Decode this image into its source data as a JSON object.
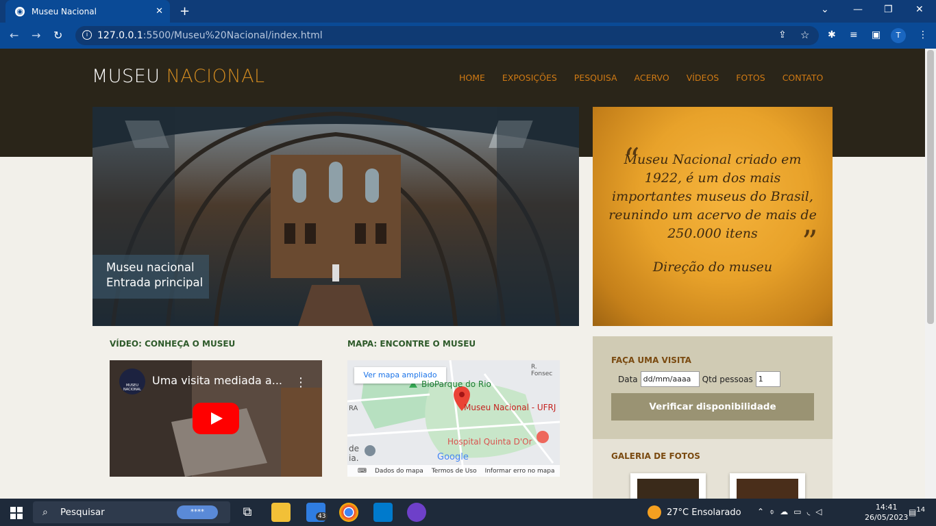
{
  "browser": {
    "tab_title": "Museu Nacional",
    "url_host": "127.0.0.1",
    "url_path": ":5500/Museu%20Nacional/index.html",
    "profile_initial": "T"
  },
  "site": {
    "logo_part1": "MUSEU ",
    "logo_part2": "NACIONAL",
    "nav": [
      "HOME",
      "EXPOSIÇÕES",
      "PESQUISA",
      "ACERVO",
      "VÍDEOS",
      "FOTOS",
      "CONTATO"
    ],
    "hero_caption_line1": "Museu nacional",
    "hero_caption_line2": "Entrada principal",
    "quote_text": "Museu Nacional criado em 1922, é um dos mais importantes museus do Brasil, reunindo um acervo de mais de 250.000 itens",
    "quote_signature": "Direção do museu",
    "video_section_title": "VÍDEO: CONHEÇA O MUSEU",
    "video_title": "Uma visita mediada a...",
    "video_logo_text": "MUSEU NACIONAL",
    "map_section_title": "MAPA: ENCONTRE O MUSEU",
    "map_button": "Ver mapa ampliado",
    "map_labels": {
      "park": "BioParque do Rio",
      "museum": "Museu Nacional - UFRJ",
      "hospital": "Hospital Quinta D'Or",
      "street": "R. Fonsec",
      "google": "Google",
      "edge_a": "RA",
      "edge_b": "de",
      "edge_c": "ia."
    },
    "map_footer": [
      "Dados do mapa",
      "Termos de Uso",
      "Informar erro no mapa"
    ],
    "visit_title": "FAÇA UMA VISITA",
    "visit_date_label": "Data",
    "visit_date_placeholder": "dd/mm/aaaa",
    "visit_qty_label": "Qtd pessoas",
    "visit_qty_value": "1",
    "visit_button": "Verificar disponibilidade",
    "gallery_title": "GALERIA DE FOTOS"
  },
  "taskbar": {
    "search_placeholder": "Pesquisar",
    "mail_badge": "43",
    "weather": "27°C  Ensolarado",
    "time": "14:41",
    "date": "26/05/2023",
    "notifications": "14"
  }
}
